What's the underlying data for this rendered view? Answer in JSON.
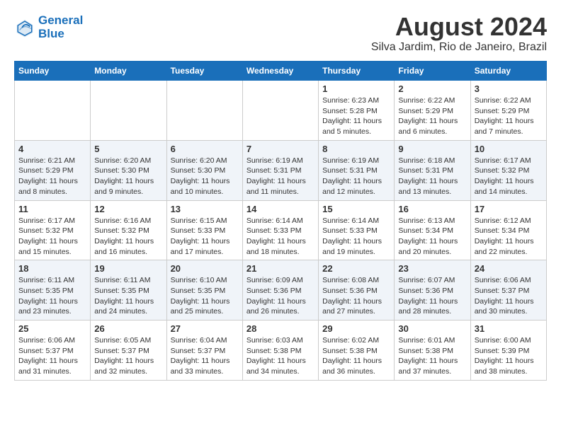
{
  "header": {
    "logo_line1": "General",
    "logo_line2": "Blue",
    "month_title": "August 2024",
    "location": "Silva Jardim, Rio de Janeiro, Brazil"
  },
  "weekdays": [
    "Sunday",
    "Monday",
    "Tuesday",
    "Wednesday",
    "Thursday",
    "Friday",
    "Saturday"
  ],
  "weeks": [
    [
      {
        "day": "",
        "info": ""
      },
      {
        "day": "",
        "info": ""
      },
      {
        "day": "",
        "info": ""
      },
      {
        "day": "",
        "info": ""
      },
      {
        "day": "1",
        "info": "Sunrise: 6:23 AM\nSunset: 5:28 PM\nDaylight: 11 hours\nand 5 minutes."
      },
      {
        "day": "2",
        "info": "Sunrise: 6:22 AM\nSunset: 5:29 PM\nDaylight: 11 hours\nand 6 minutes."
      },
      {
        "day": "3",
        "info": "Sunrise: 6:22 AM\nSunset: 5:29 PM\nDaylight: 11 hours\nand 7 minutes."
      }
    ],
    [
      {
        "day": "4",
        "info": "Sunrise: 6:21 AM\nSunset: 5:29 PM\nDaylight: 11 hours\nand 8 minutes."
      },
      {
        "day": "5",
        "info": "Sunrise: 6:20 AM\nSunset: 5:30 PM\nDaylight: 11 hours\nand 9 minutes."
      },
      {
        "day": "6",
        "info": "Sunrise: 6:20 AM\nSunset: 5:30 PM\nDaylight: 11 hours\nand 10 minutes."
      },
      {
        "day": "7",
        "info": "Sunrise: 6:19 AM\nSunset: 5:31 PM\nDaylight: 11 hours\nand 11 minutes."
      },
      {
        "day": "8",
        "info": "Sunrise: 6:19 AM\nSunset: 5:31 PM\nDaylight: 11 hours\nand 12 minutes."
      },
      {
        "day": "9",
        "info": "Sunrise: 6:18 AM\nSunset: 5:31 PM\nDaylight: 11 hours\nand 13 minutes."
      },
      {
        "day": "10",
        "info": "Sunrise: 6:17 AM\nSunset: 5:32 PM\nDaylight: 11 hours\nand 14 minutes."
      }
    ],
    [
      {
        "day": "11",
        "info": "Sunrise: 6:17 AM\nSunset: 5:32 PM\nDaylight: 11 hours\nand 15 minutes."
      },
      {
        "day": "12",
        "info": "Sunrise: 6:16 AM\nSunset: 5:32 PM\nDaylight: 11 hours\nand 16 minutes."
      },
      {
        "day": "13",
        "info": "Sunrise: 6:15 AM\nSunset: 5:33 PM\nDaylight: 11 hours\nand 17 minutes."
      },
      {
        "day": "14",
        "info": "Sunrise: 6:14 AM\nSunset: 5:33 PM\nDaylight: 11 hours\nand 18 minutes."
      },
      {
        "day": "15",
        "info": "Sunrise: 6:14 AM\nSunset: 5:33 PM\nDaylight: 11 hours\nand 19 minutes."
      },
      {
        "day": "16",
        "info": "Sunrise: 6:13 AM\nSunset: 5:34 PM\nDaylight: 11 hours\nand 20 minutes."
      },
      {
        "day": "17",
        "info": "Sunrise: 6:12 AM\nSunset: 5:34 PM\nDaylight: 11 hours\nand 22 minutes."
      }
    ],
    [
      {
        "day": "18",
        "info": "Sunrise: 6:11 AM\nSunset: 5:35 PM\nDaylight: 11 hours\nand 23 minutes."
      },
      {
        "day": "19",
        "info": "Sunrise: 6:11 AM\nSunset: 5:35 PM\nDaylight: 11 hours\nand 24 minutes."
      },
      {
        "day": "20",
        "info": "Sunrise: 6:10 AM\nSunset: 5:35 PM\nDaylight: 11 hours\nand 25 minutes."
      },
      {
        "day": "21",
        "info": "Sunrise: 6:09 AM\nSunset: 5:36 PM\nDaylight: 11 hours\nand 26 minutes."
      },
      {
        "day": "22",
        "info": "Sunrise: 6:08 AM\nSunset: 5:36 PM\nDaylight: 11 hours\nand 27 minutes."
      },
      {
        "day": "23",
        "info": "Sunrise: 6:07 AM\nSunset: 5:36 PM\nDaylight: 11 hours\nand 28 minutes."
      },
      {
        "day": "24",
        "info": "Sunrise: 6:06 AM\nSunset: 5:37 PM\nDaylight: 11 hours\nand 30 minutes."
      }
    ],
    [
      {
        "day": "25",
        "info": "Sunrise: 6:06 AM\nSunset: 5:37 PM\nDaylight: 11 hours\nand 31 minutes."
      },
      {
        "day": "26",
        "info": "Sunrise: 6:05 AM\nSunset: 5:37 PM\nDaylight: 11 hours\nand 32 minutes."
      },
      {
        "day": "27",
        "info": "Sunrise: 6:04 AM\nSunset: 5:37 PM\nDaylight: 11 hours\nand 33 minutes."
      },
      {
        "day": "28",
        "info": "Sunrise: 6:03 AM\nSunset: 5:38 PM\nDaylight: 11 hours\nand 34 minutes."
      },
      {
        "day": "29",
        "info": "Sunrise: 6:02 AM\nSunset: 5:38 PM\nDaylight: 11 hours\nand 36 minutes."
      },
      {
        "day": "30",
        "info": "Sunrise: 6:01 AM\nSunset: 5:38 PM\nDaylight: 11 hours\nand 37 minutes."
      },
      {
        "day": "31",
        "info": "Sunrise: 6:00 AM\nSunset: 5:39 PM\nDaylight: 11 hours\nand 38 minutes."
      }
    ]
  ]
}
